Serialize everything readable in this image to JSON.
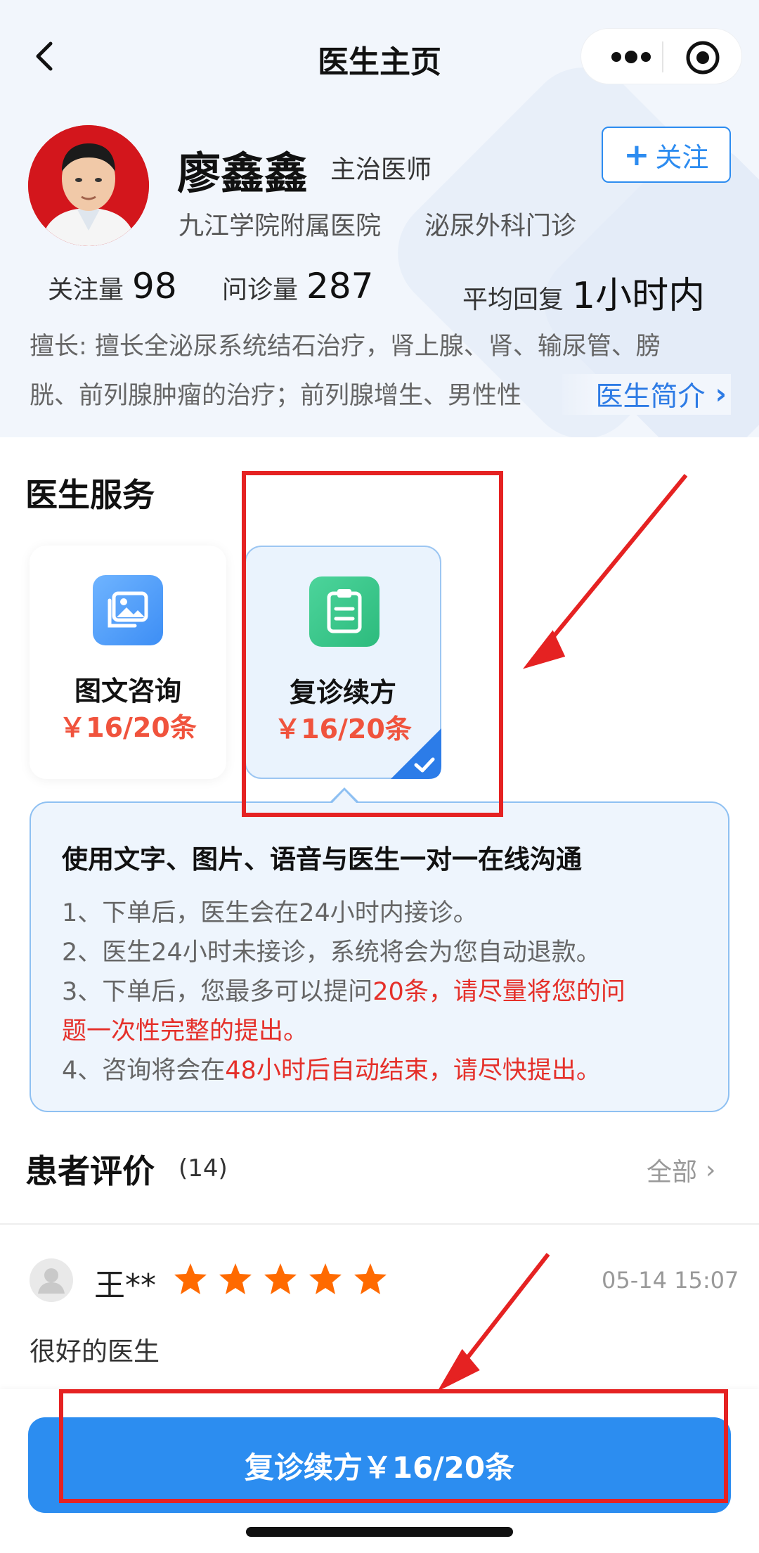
{
  "nav": {
    "title": "医生主页"
  },
  "doctor": {
    "name": "廖鑫鑫",
    "title": "主治医师",
    "follow_label": "关注",
    "hospital": "九江学院附属医院",
    "department": "泌尿外科门诊",
    "stats": [
      {
        "label": "关注量",
        "value": "98"
      },
      {
        "label": "问诊量",
        "value": "287"
      },
      {
        "label": "平均回复",
        "value": "1小时内"
      }
    ],
    "skills_line1": "擅长: 擅长全泌尿系统结石治疗，肾上腺、肾、输尿管、膀",
    "skills_line2": "胱、前列腺肿瘤的治疗；前列腺增生、男性性",
    "intro_link": "医生简介"
  },
  "services": {
    "title": "医生服务",
    "items": [
      {
        "name": "图文咨询",
        "price": "￥16/20条",
        "selected": false
      },
      {
        "name": "复诊续方",
        "price": "￥16/20条",
        "selected": true
      }
    ],
    "detail": {
      "heading": "使用文字、图片、语音与医生一对一在线沟通",
      "line1": "1、下单后，医生会在24小时内接诊。",
      "line2": "2、医生24小时未接诊，系统将会为您自动退款。",
      "line3_pre": "3、下单后，您最多可以提问",
      "line3_hl": "20条，请尽量将您的问",
      "line4_hl": "题一次性完整的提出。",
      "line5_pre": "4、咨询将会在",
      "line5_hl": "48小时后自动结束，请尽快提出。"
    }
  },
  "reviews": {
    "title": "患者评价",
    "count": "(14)",
    "all_label": "全部",
    "items": [
      {
        "name": "王**",
        "rating": 5,
        "time": "05-14 15:07",
        "text": "很好的医生"
      }
    ]
  },
  "cta": {
    "label": "复诊续方￥16/20条"
  },
  "colors": {
    "accent": "#2c8df0",
    "price": "#f0533d",
    "highlight": "#e5302a",
    "annotation": "#e52222",
    "star": "#ff6a00"
  }
}
